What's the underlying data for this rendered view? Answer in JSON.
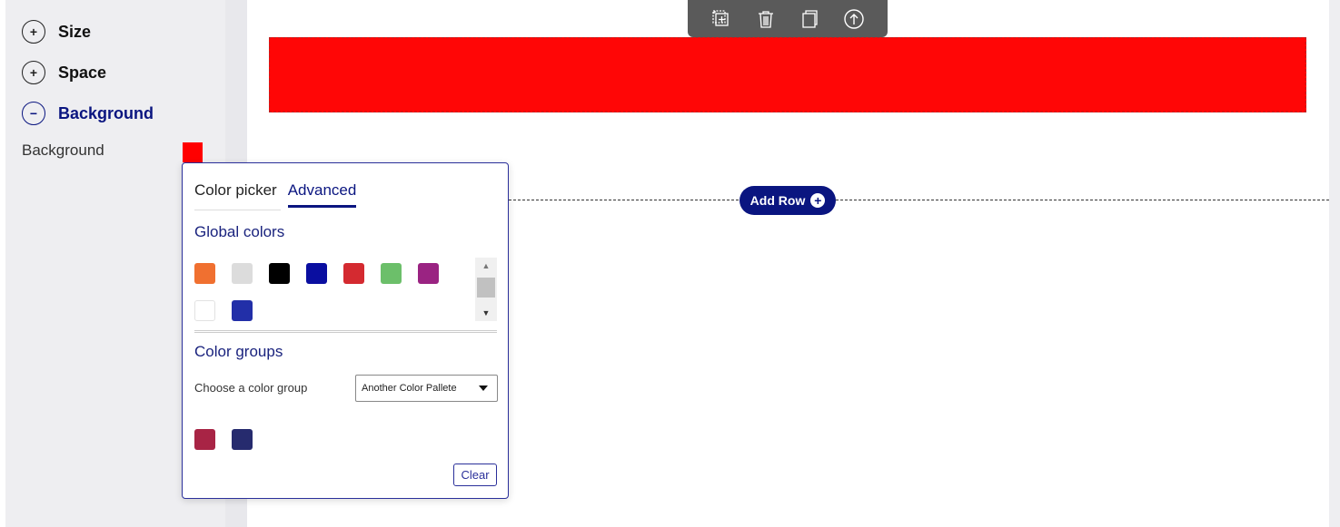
{
  "sidebar": {
    "sections": [
      {
        "label": "Size",
        "state": "+",
        "active": false
      },
      {
        "label": "Space",
        "state": "+",
        "active": false
      },
      {
        "label": "Background",
        "state": "−",
        "active": true
      }
    ],
    "background_label": "Background",
    "background_value": "#ff0000"
  },
  "toolbar": {
    "icons": [
      "add-block-icon",
      "trash-icon",
      "duplicate-icon",
      "move-up-icon"
    ]
  },
  "canvas": {
    "add_row_label": "Add Row",
    "add_row_icon": "+",
    "row_color": "#ff0606"
  },
  "popup": {
    "tabs": [
      "Color picker",
      "Advanced"
    ],
    "active_tab": "Advanced",
    "global_colors_heading": "Global colors",
    "global_colors": [
      "#f07030",
      "#dcdcdc",
      "#000000",
      "#0a0ea0",
      "#d42a30",
      "#6cbf6a",
      "#9a2382",
      "#ffffff",
      "#222fa8"
    ],
    "color_groups_heading": "Color groups",
    "choose_group_label": "Choose a color group",
    "selected_group": "Another Color Pallete",
    "group_colors": [
      "#a82445",
      "#262b6e"
    ],
    "clear_label": "Clear"
  }
}
